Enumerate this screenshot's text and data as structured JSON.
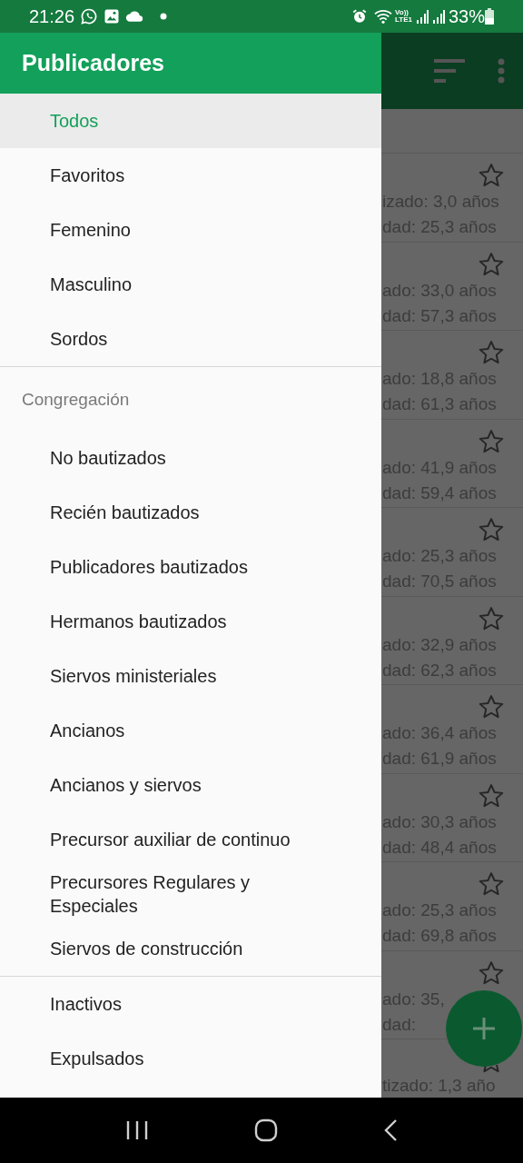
{
  "status_bar": {
    "time": "21:26",
    "volte": [
      "Vo))",
      "LTE1"
    ],
    "battery": "33%"
  },
  "drawer": {
    "title": "Publicadores",
    "sections": [
      {
        "items": [
          {
            "label": "Todos",
            "selected": true
          },
          {
            "label": "Favoritos",
            "selected": false
          },
          {
            "label": "Femenino",
            "selected": false
          },
          {
            "label": "Masculino",
            "selected": false
          },
          {
            "label": "Sordos",
            "selected": false
          }
        ]
      },
      {
        "header": "Congregación",
        "items": [
          {
            "label": "No bautizados",
            "selected": false
          },
          {
            "label": "Recién bautizados",
            "selected": false
          },
          {
            "label": "Publicadores bautizados",
            "selected": false
          },
          {
            "label": "Hermanos bautizados",
            "selected": false
          },
          {
            "label": "Siervos ministeriales",
            "selected": false
          },
          {
            "label": "Ancianos",
            "selected": false
          },
          {
            "label": "Ancianos y siervos",
            "selected": false
          },
          {
            "label": "Precursor auxiliar de continuo",
            "selected": false
          },
          {
            "label": "Precursores Regulares y Especiales",
            "selected": false
          },
          {
            "label": "Siervos de construcción",
            "selected": false
          }
        ]
      },
      {
        "items": [
          {
            "label": "Inactivos",
            "selected": false
          },
          {
            "label": "Expulsados",
            "selected": false
          }
        ]
      }
    ]
  },
  "list": {
    "rows": [
      {
        "lines": [
          "izado: 3,0 años",
          "dad: 25,3 años"
        ]
      },
      {
        "lines": [
          "ado: 33,0 años",
          "dad: 57,3 años"
        ]
      },
      {
        "lines": [
          "ado: 18,8 años",
          "dad: 61,3 años"
        ]
      },
      {
        "lines": [
          "ado: 41,9 años",
          "dad: 59,4 años"
        ]
      },
      {
        "lines": [
          "ado: 25,3 años",
          "dad: 70,5 años"
        ]
      },
      {
        "lines": [
          "ado: 32,9 años",
          "dad: 62,3 años"
        ]
      },
      {
        "lines": [
          "ado: 36,4 años",
          "dad: 61,9 años"
        ]
      },
      {
        "lines": [
          "ado: 30,3 años",
          "dad: 48,4 años"
        ]
      },
      {
        "lines": [
          "ado: 25,3 años",
          "dad: 69,8 años"
        ]
      },
      {
        "lines": [
          "ado: 35,",
          "dad:"
        ]
      },
      {
        "lines": [
          "tizado: 1,3 año"
        ]
      }
    ]
  }
}
